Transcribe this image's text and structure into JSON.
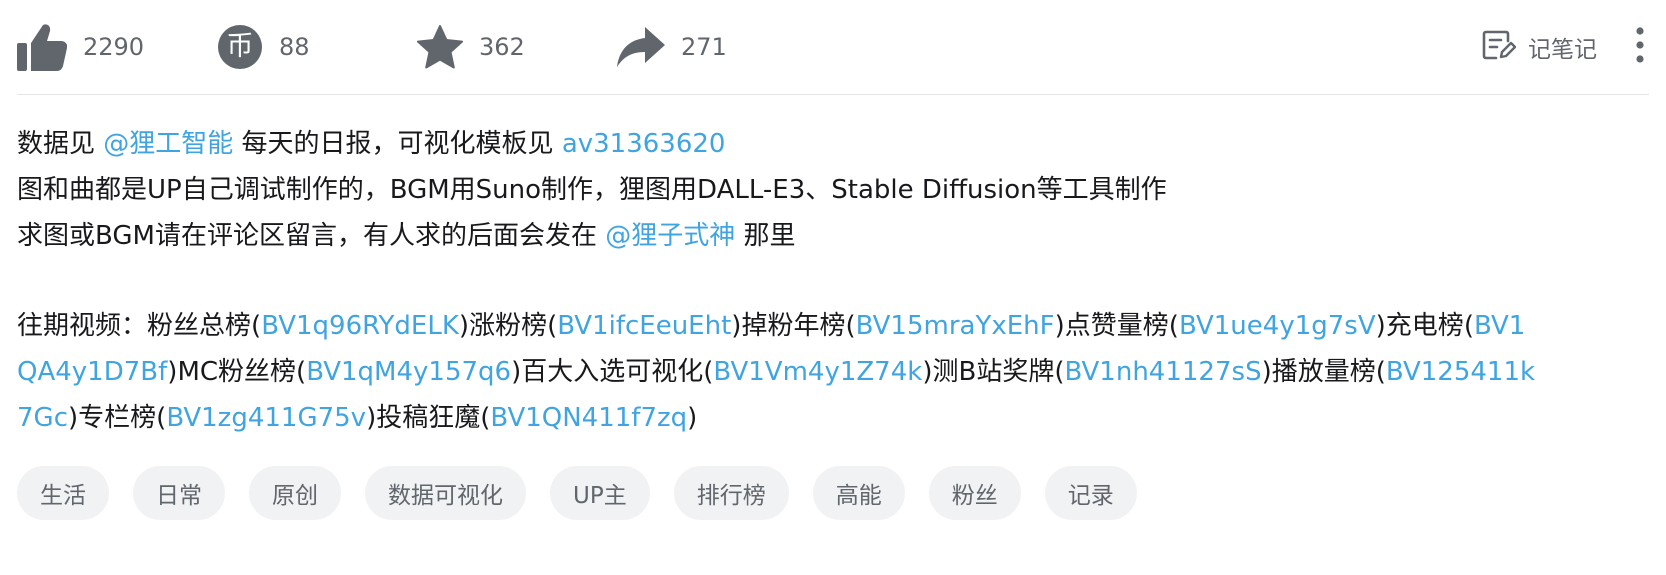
{
  "toolbar": {
    "like_count": "2290",
    "coin_count": "88",
    "favorite_count": "362",
    "share_count": "271",
    "note_label": "记笔记",
    "coin_glyph": "币",
    "icons": {
      "like": "thumbs-up-icon",
      "coin": "coin-icon",
      "favorite": "star-icon",
      "share": "share-arrow-icon",
      "note": "note-edit-icon",
      "more": "vertical-dots-icon"
    }
  },
  "description": {
    "line1_a": "数据见 ",
    "line1_link1": "@狸工智能",
    "line1_b": " 每天的日报，可视化模板见 ",
    "line1_link2": "av31363620",
    "line2": "图和曲都是UP自己调试制作的，BGM用Suno制作，狸图用DALL-E3、Stable Diffusion等工具制作",
    "line3_a": "求图或BGM请在评论区留言，有人求的后面会发在 ",
    "line3_link": "@狸子式神",
    "line3_b": " 那里",
    "past_prefix": "往期视频：",
    "past_videos": [
      {
        "title": "粉丝总榜",
        "bv": "BV1q96RYdELK"
      },
      {
        "title": "涨粉榜",
        "bv": "BV1ifcEeuEht"
      },
      {
        "title": "掉粉年榜",
        "bv": "BV15mraYxEhF"
      },
      {
        "title": "点赞量榜",
        "bv": "BV1ue4y1g7sV"
      },
      {
        "title": "充电榜",
        "bv": "BV1QA4y1D7Bf"
      },
      {
        "title": "MC粉丝榜",
        "bv": "BV1qM4y157q6"
      },
      {
        "title": "百大入选可视化",
        "bv": "BV1Vm4y1Z74k"
      },
      {
        "title": "测B站奖牌",
        "bv": "BV1nh41127sS"
      },
      {
        "title": "播放量榜",
        "bv": "BV125411k7Gc"
      },
      {
        "title": "专栏榜",
        "bv": "BV1zg411G75v"
      },
      {
        "title": "投稿狂魔",
        "bv": "BV1QN411f7zq"
      }
    ],
    "open_paren": "(",
    "close_paren": ")"
  },
  "tags": [
    "生活",
    "日常",
    "原创",
    "数据可视化",
    "UP主",
    "排行榜",
    "高能",
    "粉丝",
    "记录"
  ],
  "colors": {
    "link": "#3fa4e0",
    "icon": "#61666d",
    "tag_bg": "#f1f2f3",
    "text": "#18191c",
    "divider": "#e3e5e7"
  }
}
